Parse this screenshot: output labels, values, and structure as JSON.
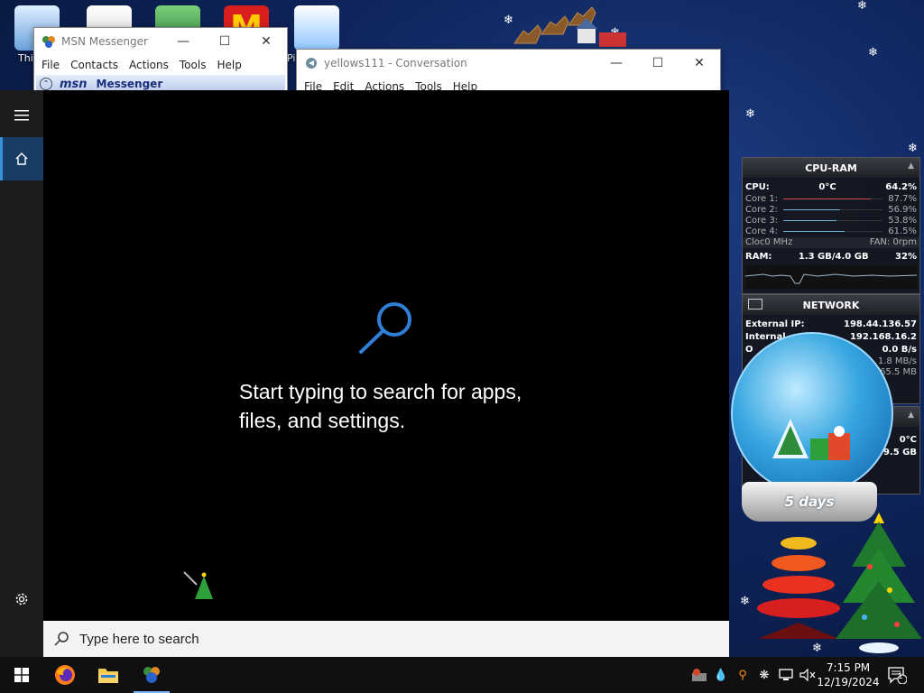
{
  "desktop": {
    "icon_labels": [
      "Thi",
      "Pi"
    ],
    "countdown": "5 days"
  },
  "msn_window": {
    "title": "MSN Messenger",
    "menu": [
      "File",
      "Contacts",
      "Actions",
      "Tools",
      "Help"
    ],
    "banner_logo": "msn",
    "banner_text": "Messenger"
  },
  "conversation_window": {
    "title": "yellows111 - Conversation",
    "menu": [
      "File",
      "Edit",
      "Actions",
      "Tools",
      "Help"
    ]
  },
  "search": {
    "hint_line1": "Start typing to search for apps,",
    "hint_line2": "files, and settings.",
    "placeholder": "Type here to search"
  },
  "cpu_gadget": {
    "title": "CPU-RAM",
    "cpu_label": "CPU:",
    "cpu_temp": "0°C",
    "cpu_percent": "64.2%",
    "cores": [
      {
        "label": "Core 1:",
        "value": "87.7%",
        "fill": 0.877
      },
      {
        "label": "Core 2:",
        "value": "56.9%",
        "fill": 0.569
      },
      {
        "label": "Core 3:",
        "value": "53.8%",
        "fill": 0.538
      },
      {
        "label": "Core 4:",
        "value": "61.5%",
        "fill": 0.615
      }
    ],
    "clock_label": "Cloc",
    "clock_value": "0 MHz",
    "fan": "FAN: 0rpm",
    "ram_label": "RAM:",
    "ram_value": "1.3 GB/4.0 GB",
    "ram_percent": "32%"
  },
  "network_gadget": {
    "title": "NETWORK",
    "external_label": "External IP:",
    "external_ip": "198.44.136.57",
    "internal_label": "Internal",
    "internal_ip": "192.168.16.2",
    "row3_label": "O",
    "row3_value": "0.0 B/s",
    "row4_value": "1.8 MB/s",
    "row5_value": "65.5 MB"
  },
  "third_gadget": {
    "temp": "0°C",
    "value": "9.5 GB"
  },
  "taskbar": {
    "time": "7:15 PM",
    "date": "12/19/2024",
    "notification_count": "1"
  },
  "colors": {
    "accent": "#3a8fdc",
    "search_icon": "#2f7fd6",
    "rail": "#1c1c1c",
    "taskbar": "#101010"
  }
}
